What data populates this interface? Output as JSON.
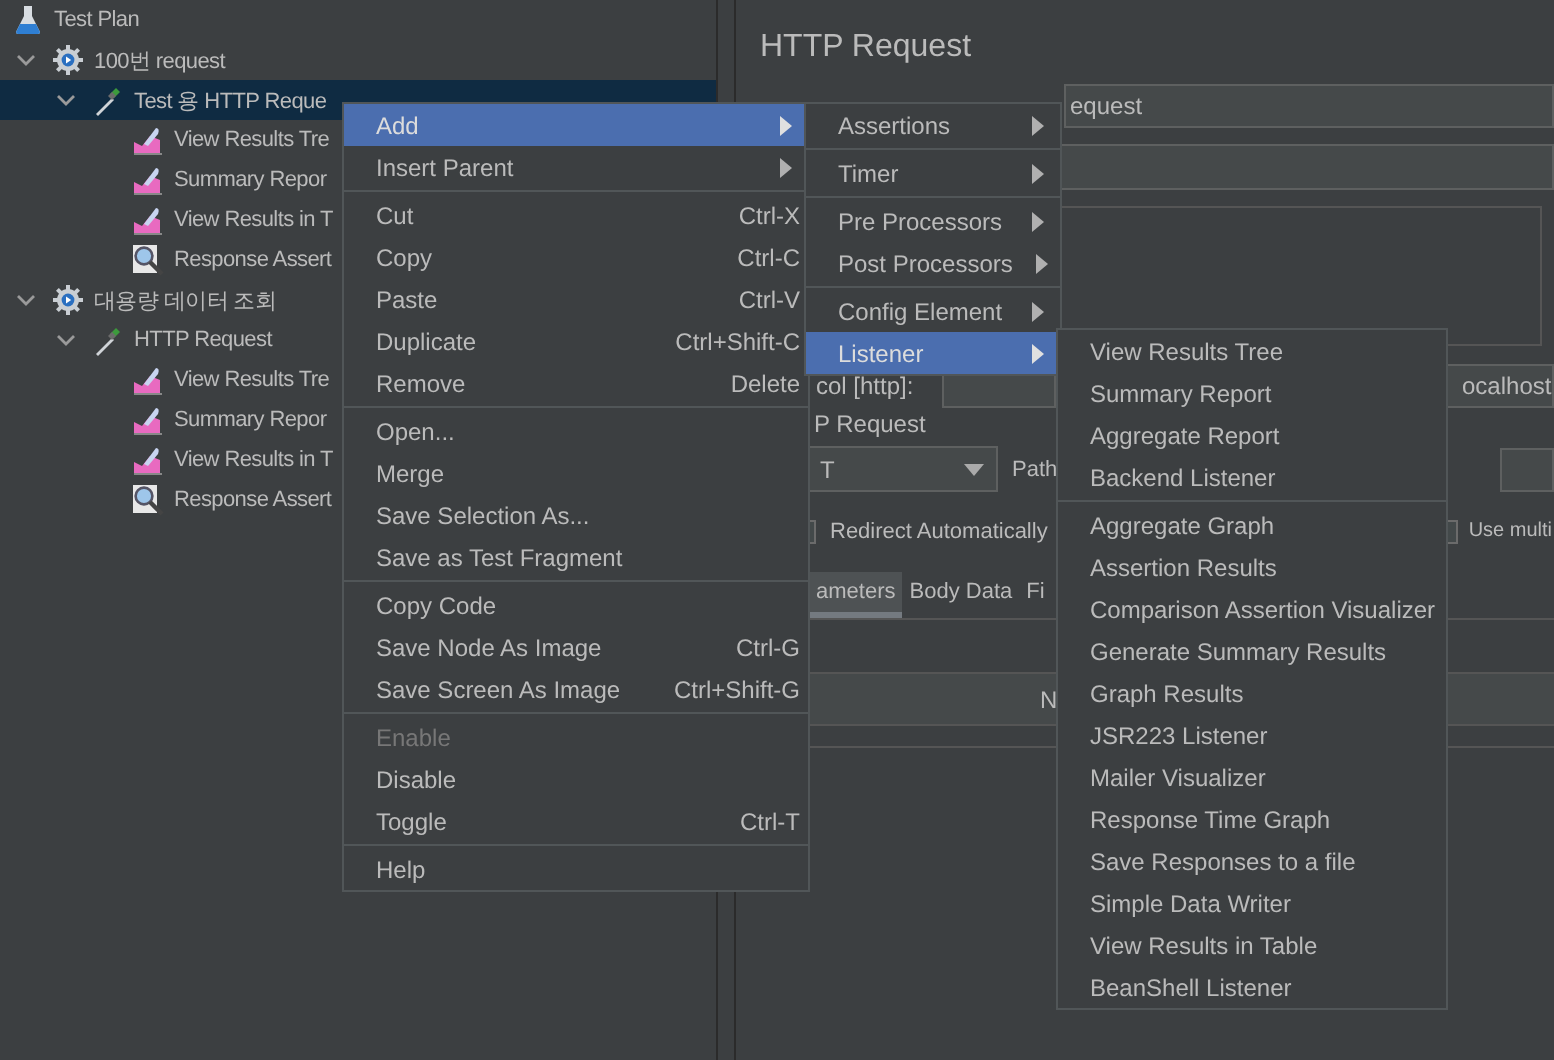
{
  "tree": [
    {
      "label": "Test Plan",
      "kind": "plan",
      "selected": false,
      "children": [
        {
          "label": "100번 request",
          "kind": "thread-group",
          "selected": false,
          "expanded": true,
          "children": [
            {
              "label": "Test 용 HTTP Reque",
              "kind": "sampler",
              "selected": true,
              "expanded": true,
              "children": [
                {
                  "label": "View Results Tre",
                  "kind": "listener",
                  "selected": false
                },
                {
                  "label": "Summary Repor",
                  "kind": "listener",
                  "selected": false
                },
                {
                  "label": "View Results in T",
                  "kind": "listener",
                  "selected": false
                },
                {
                  "label": "Response Assert",
                  "kind": "assertion",
                  "selected": false
                }
              ]
            }
          ]
        },
        {
          "label": "대용량 데이터 조회",
          "kind": "thread-group",
          "selected": false,
          "expanded": true,
          "children": [
            {
              "label": "HTTP Request",
              "kind": "sampler",
              "selected": false,
              "expanded": true,
              "children": [
                {
                  "label": "View Results Tre",
                  "kind": "listener",
                  "selected": false
                },
                {
                  "label": "Summary Repor",
                  "kind": "listener",
                  "selected": false
                },
                {
                  "label": "View Results in T",
                  "kind": "listener",
                  "selected": false
                },
                {
                  "label": "Response Assert",
                  "kind": "assertion",
                  "selected": false
                }
              ]
            }
          ]
        }
      ]
    }
  ],
  "editor": {
    "title": "HTTP Request",
    "name_field": {
      "value": "equest"
    },
    "protocol_label": "col [http]:",
    "server_field": {
      "value": "ocalhost"
    },
    "section_label": "P Request",
    "method_field": {
      "value": "T"
    },
    "path_label": "Path",
    "checkboxes": [
      {
        "label": "Redirect Automatically",
        "checked": false
      },
      {
        "label": "Use multi",
        "checked": false
      }
    ],
    "tabs": [
      {
        "label": "ameters",
        "selected": true
      },
      {
        "label": "Body Data",
        "selected": false
      },
      {
        "label": "Fi",
        "selected": false
      }
    ],
    "table": {
      "columns": [
        "N"
      ]
    }
  },
  "context_menu": {
    "items": [
      {
        "kind": "item",
        "label": "Add",
        "submenu": true,
        "selected": true,
        "disabled": false
      },
      {
        "kind": "item",
        "label": "Insert Parent",
        "submenu": true,
        "selected": false,
        "disabled": false
      },
      {
        "kind": "separator"
      },
      {
        "kind": "item",
        "label": "Cut",
        "shortcut": "Ctrl-X",
        "selected": false,
        "disabled": false
      },
      {
        "kind": "item",
        "label": "Copy",
        "shortcut": "Ctrl-C",
        "selected": false,
        "disabled": false
      },
      {
        "kind": "item",
        "label": "Paste",
        "shortcut": "Ctrl-V",
        "selected": false,
        "disabled": false
      },
      {
        "kind": "item",
        "label": "Duplicate",
        "shortcut": "Ctrl+Shift-C",
        "selected": false,
        "disabled": false
      },
      {
        "kind": "item",
        "label": "Remove",
        "shortcut": "Delete",
        "selected": false,
        "disabled": false
      },
      {
        "kind": "separator"
      },
      {
        "kind": "item",
        "label": "Open...",
        "selected": false,
        "disabled": false
      },
      {
        "kind": "item",
        "label": "Merge",
        "selected": false,
        "disabled": false
      },
      {
        "kind": "item",
        "label": "Save Selection As...",
        "selected": false,
        "disabled": false
      },
      {
        "kind": "item",
        "label": "Save as Test Fragment",
        "selected": false,
        "disabled": false
      },
      {
        "kind": "separator"
      },
      {
        "kind": "item",
        "label": "Copy Code",
        "selected": false,
        "disabled": false
      },
      {
        "kind": "item",
        "label": "Save Node As Image",
        "shortcut": "Ctrl-G",
        "selected": false,
        "disabled": false
      },
      {
        "kind": "item",
        "label": "Save Screen As Image",
        "shortcut": "Ctrl+Shift-G",
        "selected": false,
        "disabled": false
      },
      {
        "kind": "separator"
      },
      {
        "kind": "item",
        "label": "Enable",
        "selected": false,
        "disabled": true
      },
      {
        "kind": "item",
        "label": "Disable",
        "selected": false,
        "disabled": false
      },
      {
        "kind": "item",
        "label": "Toggle",
        "shortcut": "Ctrl-T",
        "selected": false,
        "disabled": false
      },
      {
        "kind": "separator"
      },
      {
        "kind": "item",
        "label": "Help",
        "selected": false,
        "disabled": false
      }
    ]
  },
  "add_submenu": {
    "items": [
      {
        "kind": "item",
        "label": "Assertions",
        "submenu": true,
        "selected": false,
        "disabled": false
      },
      {
        "kind": "separator"
      },
      {
        "kind": "item",
        "label": "Timer",
        "submenu": true,
        "selected": false,
        "disabled": false
      },
      {
        "kind": "separator"
      },
      {
        "kind": "item",
        "label": "Pre Processors",
        "submenu": true,
        "selected": false,
        "disabled": false
      },
      {
        "kind": "item",
        "label": "Post Processors",
        "submenu": true,
        "selected": false,
        "disabled": false
      },
      {
        "kind": "separator"
      },
      {
        "kind": "item",
        "label": "Config Element",
        "submenu": true,
        "selected": false,
        "disabled": false
      },
      {
        "kind": "item",
        "label": "Listener",
        "submenu": true,
        "selected": true,
        "disabled": false
      }
    ]
  },
  "listener_submenu": {
    "items": [
      {
        "kind": "item",
        "label": "View Results Tree",
        "selected": false,
        "disabled": false
      },
      {
        "kind": "item",
        "label": "Summary Report",
        "selected": false,
        "disabled": false
      },
      {
        "kind": "item",
        "label": "Aggregate Report",
        "selected": false,
        "disabled": false
      },
      {
        "kind": "item",
        "label": "Backend Listener",
        "selected": false,
        "disabled": false
      },
      {
        "kind": "separator"
      },
      {
        "kind": "item",
        "label": "Aggregate Graph",
        "selected": false,
        "disabled": false
      },
      {
        "kind": "item",
        "label": "Assertion Results",
        "selected": false,
        "disabled": false
      },
      {
        "kind": "item",
        "label": "Comparison Assertion Visualizer",
        "selected": false,
        "disabled": false
      },
      {
        "kind": "item",
        "label": "Generate Summary Results",
        "selected": false,
        "disabled": false
      },
      {
        "kind": "item",
        "label": "Graph Results",
        "selected": false,
        "disabled": false
      },
      {
        "kind": "item",
        "label": "JSR223 Listener",
        "selected": false,
        "disabled": false
      },
      {
        "kind": "item",
        "label": "Mailer Visualizer",
        "selected": false,
        "disabled": false
      },
      {
        "kind": "item",
        "label": "Response Time Graph",
        "selected": false,
        "disabled": false
      },
      {
        "kind": "item",
        "label": "Save Responses to a file",
        "selected": false,
        "disabled": false
      },
      {
        "kind": "item",
        "label": "Simple Data Writer",
        "selected": false,
        "disabled": false
      },
      {
        "kind": "item",
        "label": "View Results in Table",
        "selected": false,
        "disabled": false
      },
      {
        "kind": "item",
        "label": "BeanShell Listener",
        "selected": false,
        "disabled": false
      }
    ]
  }
}
